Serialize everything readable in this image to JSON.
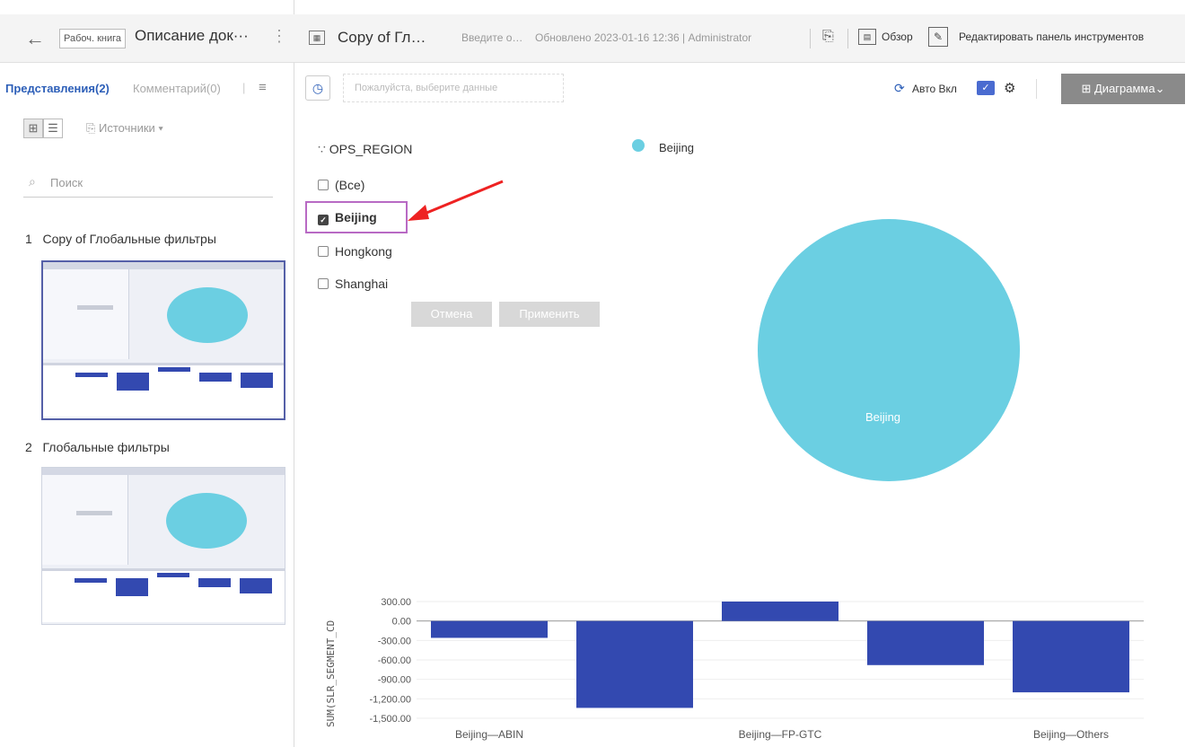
{
  "left": {
    "workbook_tag": "Рабоч. книга",
    "workbook_title": "Описание док···",
    "tabs": {
      "views": "Представления(2)",
      "comments": "Комментарий(0)"
    },
    "sources_label": "Источники ▾",
    "search_placeholder": "Поиск",
    "views": [
      {
        "index": "1",
        "title": "Copy of Глобальные фильтры"
      },
      {
        "index": "2",
        "title": "Глобальные фильтры"
      }
    ]
  },
  "header": {
    "doc_title": "Copy of Гл…",
    "description": "Введите о…",
    "updated": "Обновлено 2023-01-16 12:36 | Administrator",
    "overview": "Обзор",
    "edit_toolbar": "Редактировать панель инструментов"
  },
  "filterbar": {
    "data_placeholder": "Пожалуйста, выберите данные",
    "auto_label": "Авто Вкл",
    "chart_button": "Диаграмма"
  },
  "filter": {
    "field": "OPS_REGION",
    "items": [
      {
        "label": "(Все)",
        "checked": false
      },
      {
        "label": "Beijing",
        "checked": true
      },
      {
        "label": "Hongkong",
        "checked": false
      },
      {
        "label": "Shanghai",
        "checked": false
      }
    ],
    "cancel": "Отмена",
    "apply": "Применить"
  },
  "pie": {
    "legend": "Beijing",
    "slice_label": "Beijing",
    "color": "#6bcfe2"
  },
  "chart_data": {
    "type": "bar",
    "categories": [
      "Beijing—ABIN",
      "",
      "Beijing—FP-GTC",
      "",
      "Beijing—Others"
    ],
    "values": [
      -260,
      -1340,
      300,
      -680,
      -1100
    ],
    "ylabel": "SUM(SLR_SEGMENT_CD",
    "yticks": [
      "300.00",
      "0.00",
      "-300.00",
      "-600.00",
      "-900.00",
      "-1,200.00",
      "-1,500.00"
    ],
    "ylim": [
      -1500,
      300
    ],
    "color": "#3349b0"
  }
}
